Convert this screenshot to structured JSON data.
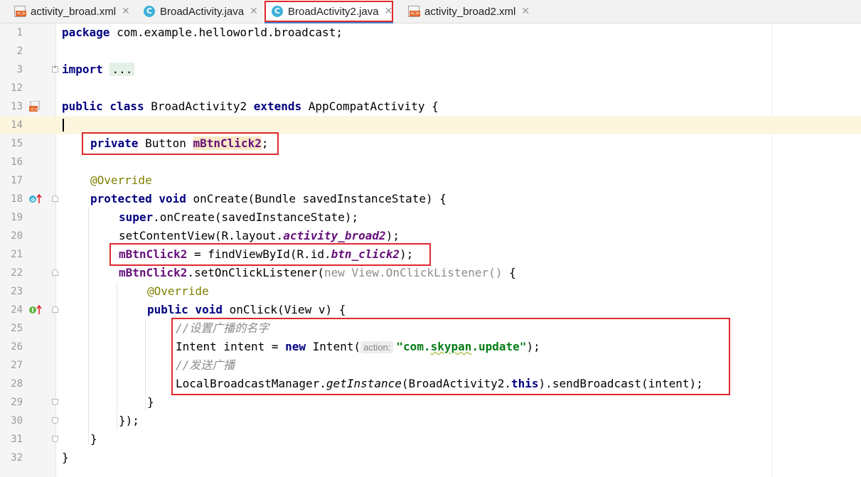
{
  "tabs": [
    {
      "label": "activity_broad.xml",
      "type": "xml",
      "active": false
    },
    {
      "label": "BroadActivity.java",
      "type": "java",
      "active": false
    },
    {
      "label": "BroadActivity2.java",
      "type": "java",
      "active": true
    },
    {
      "label": "activity_broad2.xml",
      "type": "xml",
      "active": false
    }
  ],
  "line_numbers": [
    "1",
    "2",
    "3",
    "12",
    "13",
    "14",
    "15",
    "16",
    "17",
    "18",
    "19",
    "20",
    "21",
    "22",
    "23",
    "24",
    "25",
    "26",
    "27",
    "28",
    "29",
    "30",
    "31",
    "32"
  ],
  "code": {
    "l1_kw": "package",
    "l1_rest": " com.example.helloworld.broadcast;",
    "l3_kw": "import",
    "l3_fold": "...",
    "l13_kw1": "public class",
    "l13_name": " BroadActivity2 ",
    "l13_kw2": "extends",
    "l13_rest": " AppCompatActivity {",
    "l15_kw": "private",
    "l15_type": " Button ",
    "l15_field": "mBtnClick2",
    "l15_end": ";",
    "l17_ann": "@Override",
    "l18_kw": "protected void",
    "l18_rest": " onCreate(Bundle savedInstanceState) {",
    "l19_kw": "super",
    "l19_rest": ".onCreate(savedInstanceState);",
    "l20_a": "setContentView(R.layout.",
    "l20_field": "activity_broad2",
    "l20_b": ");",
    "l21_field": "mBtnClick2",
    "l21_a": " = findViewById(R.id.",
    "l21_id": "btn_click2",
    "l21_b": ");",
    "l22_field": "mBtnClick2",
    "l22_a": ".setOnClickListener(",
    "l22_kw": "new",
    "l22_gray": " View.OnClickListener()",
    "l22_b": " {",
    "l23_ann": "@Override",
    "l24_kw": "public void",
    "l24_rest": " onClick(View v) {",
    "l25_cmt": "//设置广播的名字",
    "l26_a": "Intent intent = ",
    "l26_kw": "new",
    "l26_b": " Intent(",
    "l26_hint": "action:",
    "l26_str_q1": "\"",
    "l26_str_a": "com.",
    "l26_str_sq": "skypan",
    "l26_str_b": ".update",
    "l26_str_q2": "\"",
    "l26_c": ");",
    "l27_cmt": "//发送广播",
    "l28_a": "LocalBroadcastManager.",
    "l28_it": "getInstance",
    "l28_b": "(BroadActivity2.",
    "l28_kw": "this",
    "l28_c": ").sendBroadcast(intent);",
    "l29": "}",
    "l30": "});",
    "l31": "}",
    "l32": "}"
  },
  "gutter_icons": {
    "l13": "layout-link-icon",
    "l18": "override-up-icon",
    "l24": "implement-up-icon"
  },
  "colors": {
    "keyword": "#000080",
    "annotation": "#808000",
    "field": "#660e7a",
    "string": "#067d17",
    "comment": "#8c8c8c",
    "highlight_box": "#e0282e",
    "current_line": "#fcf6df"
  }
}
